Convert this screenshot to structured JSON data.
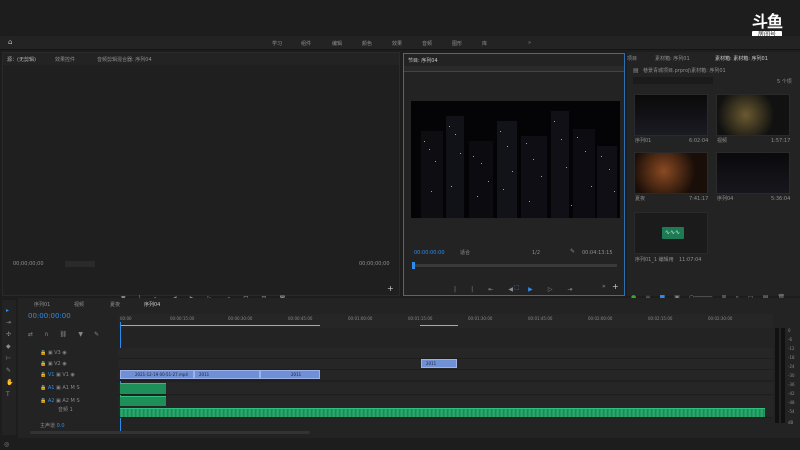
{
  "workspace": {
    "items": [
      "学习",
      "组件",
      "编辑",
      "颜色",
      "效果",
      "音频",
      "图形",
      "库"
    ],
    "more": "»"
  },
  "watermark": {
    "logo": "斗鱼",
    "room": "房间号",
    "number": "5024877"
  },
  "source_panel": {
    "tabs": [
      "源：(无剪辑)",
      "效果控件",
      "音频剪辑混合器: 序列04"
    ],
    "tc_left": "00;00;00;00",
    "tc_right": "00;00;00;00"
  },
  "program_panel": {
    "tab": "节目: 序列04",
    "timecode": "00:00:00:00",
    "fit": "适合",
    "quality": "1/2",
    "duration": "00:04:13:15"
  },
  "project_panel": {
    "tabs": [
      "项目",
      "素材箱: 序列01",
      "素材箱: 素材箱: 序列01"
    ],
    "path": "巷景青城项目.prproj\\素材箱: 序列01",
    "count": "5 个项",
    "items": [
      {
        "name": "序列01",
        "dur": "6:02:04"
      },
      {
        "name": "视频",
        "dur": "1:57:17"
      },
      {
        "name": "夏夜",
        "dur": "7:41:17"
      },
      {
        "name": "序列04",
        "dur": "5:36:04"
      },
      {
        "name": "序列01_1 编辑用",
        "dur": "11:07:04"
      }
    ]
  },
  "timeline": {
    "tabs": [
      "序列01",
      "视频",
      "夏夜",
      "序列04"
    ],
    "timecode": "00:00:00:00",
    "ruler": [
      "00:00",
      "00:00:15:00",
      "00:00:30:00",
      "00:00:45:00",
      "00:01:00:00",
      "00:01:15:00",
      "00:01:30:00",
      "00:01:45:00",
      "00:02:00:00",
      "00:02:15:00",
      "00:02:30:00"
    ],
    "tracks": {
      "v3": "V3",
      "v2": "V2",
      "v1": "V1",
      "a1": "A1",
      "a2": "A2",
      "a_label": "音频 1",
      "master": "主声道",
      "master_val": "0.0"
    },
    "clips": [
      "2021-12-19 00-51-27.mp4",
      "2011",
      "2011",
      "2011"
    ]
  },
  "meters": {
    "labels": [
      "0",
      "-6",
      "-12",
      "-18",
      "-24",
      "-30",
      "-36",
      "-42",
      "-48",
      "-54",
      "dB"
    ]
  }
}
